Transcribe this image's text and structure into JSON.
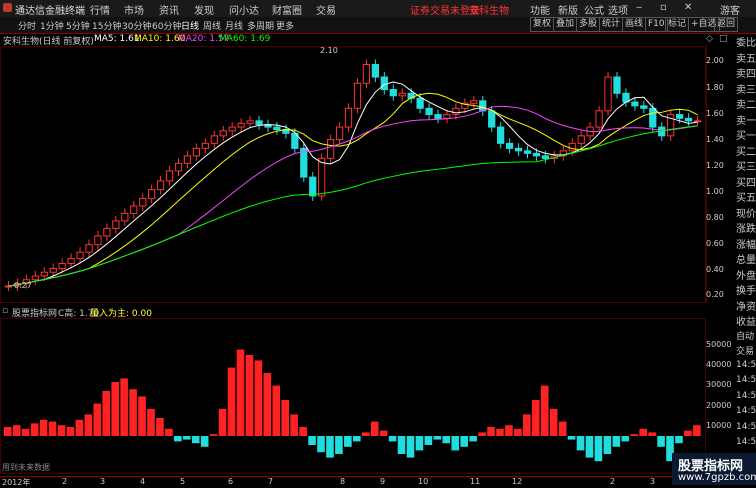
{
  "titlebar": {
    "app_name": "通达信金融终端",
    "menus": [
      "行情",
      "市场",
      "资讯",
      "发现",
      "问小达",
      "财富圈",
      "交易"
    ],
    "notice": "证券交易未登录",
    "stock_name_red": "安科生物",
    "right_items": [
      "功能",
      "新版",
      "公式",
      "选项"
    ],
    "guest": "游客"
  },
  "toolbar": {
    "periods": [
      "分时",
      "1分钟",
      "5分钟",
      "15分钟",
      "30分钟",
      "60分钟",
      "日线",
      "周线",
      "月线",
      "多周期",
      "更多"
    ],
    "right_buttons": [
      "复权",
      "叠加",
      "多股",
      "统计",
      "画线",
      "F10",
      "标记",
      "+自选",
      "返回"
    ]
  },
  "indicator": {
    "title": "安科生物(日线 前复权)",
    "ma5": "MA5: 1.61",
    "ma10": "MA10: 1.60",
    "ma20": "MA20: 1.57",
    "ma60": "MA60: 1.69",
    "colors": {
      "ma5": "#ffffff",
      "ma10": "#ffff00",
      "ma20": "#ff44ff",
      "ma60": "#00ff00"
    }
  },
  "price_axis": [
    "2.00",
    "1.80",
    "1.60",
    "1.40",
    "1.20",
    "1.00",
    "0.80",
    "0.60",
    "0.40",
    "0.20"
  ],
  "annotations": {
    "high": "2.10",
    "low": "0.27"
  },
  "sub_indicator": {
    "name": "股票指标网",
    "c_high": "C高: 1.70",
    "volume_main": "量入为主: 0.00",
    "colors": {
      "pos": "#ff2222",
      "neg": "#22dddd",
      "mid": "#ffff33"
    }
  },
  "sub_axis": [
    "50000",
    "40000",
    "30000",
    "20000",
    "10000"
  ],
  "date_axis": [
    "2012年",
    "2",
    "3",
    "4",
    "5",
    "6",
    "7",
    "8",
    "9",
    "10",
    "11",
    "12",
    "2",
    "3"
  ],
  "status_text": "用到未来数据",
  "right_panel": [
    "委比",
    "卖五",
    "卖四",
    "卖三",
    "卖二",
    "卖一",
    "买一",
    "买二",
    "买三",
    "买四",
    "买五",
    "现价",
    "涨跌",
    "涨幅",
    "总量",
    "外盘",
    "换手",
    "净资",
    "收益",
    "自动",
    "交易",
    "14:50",
    "14:50",
    "14:50",
    "14:50",
    "14:50",
    "14:50",
    "14:50",
    "14:50"
  ],
  "watermark": {
    "line1": "股票指标网",
    "line2": "www.7gpzb.com"
  },
  "chart_data": {
    "type": "candlestick",
    "x_range": [
      0,
      275
    ],
    "y_range": [
      0.2,
      2.15
    ],
    "closes": [
      0.28,
      0.3,
      0.33,
      0.36,
      0.39,
      0.42,
      0.46,
      0.5,
      0.55,
      0.61,
      0.68,
      0.74,
      0.8,
      0.86,
      0.92,
      0.98,
      1.05,
      1.12,
      1.2,
      1.26,
      1.32,
      1.38,
      1.42,
      1.48,
      1.52,
      1.55,
      1.58,
      1.6,
      1.57,
      1.55,
      1.53,
      1.5,
      1.38,
      1.15,
      1.0,
      1.3,
      1.45,
      1.55,
      1.7,
      1.9,
      2.05,
      1.95,
      1.85,
      1.8,
      1.82,
      1.78,
      1.7,
      1.65,
      1.62,
      1.65,
      1.7,
      1.74,
      1.76,
      1.68,
      1.55,
      1.42,
      1.38,
      1.36,
      1.34,
      1.32,
      1.3,
      1.32,
      1.36,
      1.42,
      1.48,
      1.55,
      1.68,
      1.95,
      1.82,
      1.75,
      1.72,
      1.7,
      1.55,
      1.48,
      1.65,
      1.62,
      1.6,
      1.6
    ],
    "sub_values": [
      5000,
      6000,
      4000,
      7000,
      9000,
      8000,
      6000,
      5000,
      9000,
      12000,
      18000,
      25000,
      30000,
      32000,
      26000,
      22000,
      15000,
      10000,
      4000,
      -3000,
      -2000,
      -4000,
      -6000,
      1000,
      15000,
      38000,
      48000,
      45000,
      42000,
      35000,
      28000,
      20000,
      12000,
      5000,
      -5000,
      -9000,
      -12000,
      -10000,
      -6000,
      -3000,
      2000,
      8000,
      3000,
      -3000,
      -10000,
      -12000,
      -8000,
      -5000,
      -2000,
      -4000,
      -8000,
      -6000,
      -3000,
      2000,
      5000,
      4000,
      6000,
      4000,
      12000,
      20000,
      28000,
      15000,
      8000,
      -2000,
      -8000,
      -12000,
      -14000,
      -10000,
      -6000,
      -3000,
      1000,
      4000,
      2000,
      -6000,
      -14000,
      -4000,
      3000,
      6000
    ]
  }
}
